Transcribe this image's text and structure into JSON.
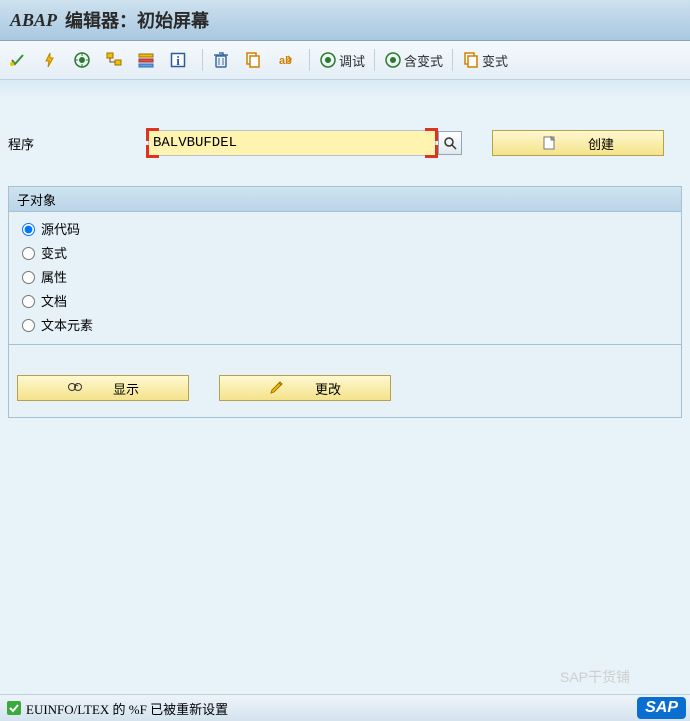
{
  "title": {
    "app": "ABAP",
    "rest": "编辑器：初始屏幕"
  },
  "toolbar": {
    "debug_label": "调试",
    "with_variant_label": "含变式",
    "variant_label": "变式"
  },
  "program": {
    "label": "程序",
    "value": "BALVBUFDEL",
    "create_label": "创建"
  },
  "subobject": {
    "title": "子对象",
    "options": [
      {
        "label": "源代码",
        "selected": true
      },
      {
        "label": "变式",
        "selected": false
      },
      {
        "label": "属性",
        "selected": false
      },
      {
        "label": "文档",
        "selected": false
      },
      {
        "label": "文本元素",
        "selected": false
      }
    ]
  },
  "actions": {
    "display_label": "显示",
    "change_label": "更改"
  },
  "status": {
    "text": "EUINFO/LTEX 的 %F 已被重新设置"
  },
  "watermark": "SAP干货铺",
  "logo": "SAP"
}
